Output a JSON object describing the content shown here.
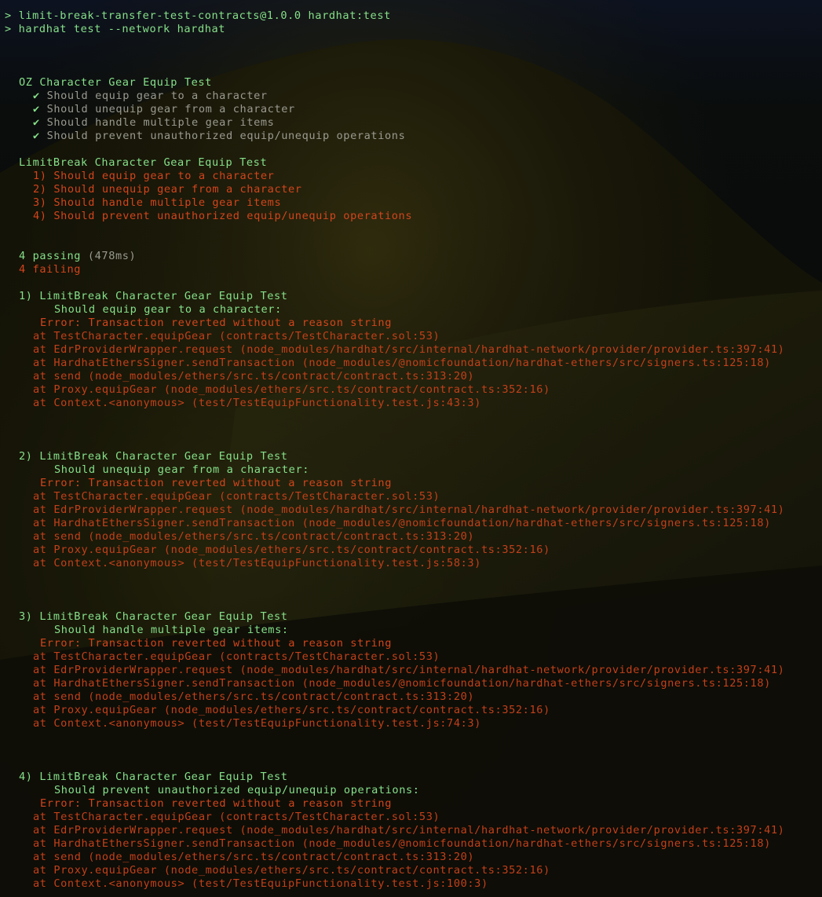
{
  "command_lines": [
    "> limit-break-transfer-test-contracts@1.0.0 hardhat:test",
    "> hardhat test --network hardhat"
  ],
  "suites": [
    {
      "title": "OZ Character Gear Equip Test",
      "status": "passed",
      "tests": [
        "✔ Should equip gear to a character",
        "✔ Should unequip gear from a character",
        "✔ Should handle multiple gear items",
        "✔ Should prevent unauthorized equip/unequip operations"
      ]
    },
    {
      "title": "LimitBreak Character Gear Equip Test",
      "status": "failed",
      "tests": [
        "1) Should equip gear to a character",
        "2) Should unequip gear from a character",
        "3) Should handle multiple gear items",
        "4) Should prevent unauthorized equip/unequip operations"
      ]
    }
  ],
  "summary": {
    "passing": "4 passing",
    "passing_time": "(478ms)",
    "failing": "4 failing"
  },
  "failures": [
    {
      "header": "1) LimitBreak Character Gear Equip Test",
      "test": "Should equip gear to a character:",
      "error": "Error: Transaction reverted without a reason string",
      "stack": [
        "at TestCharacter.equipGear (contracts/TestCharacter.sol:53)",
        "at EdrProviderWrapper.request (node_modules/hardhat/src/internal/hardhat-network/provider/provider.ts:397:41)",
        "at HardhatEthersSigner.sendTransaction (node_modules/@nomicfoundation/hardhat-ethers/src/signers.ts:125:18)",
        "at send (node_modules/ethers/src.ts/contract/contract.ts:313:20)",
        "at Proxy.equipGear (node_modules/ethers/src.ts/contract/contract.ts:352:16)",
        "at Context.<anonymous> (test/TestEquipFunctionality.test.js:43:3)"
      ]
    },
    {
      "header": "2) LimitBreak Character Gear Equip Test",
      "test": "Should unequip gear from a character:",
      "error": "Error: Transaction reverted without a reason string",
      "stack": [
        "at TestCharacter.equipGear (contracts/TestCharacter.sol:53)",
        "at EdrProviderWrapper.request (node_modules/hardhat/src/internal/hardhat-network/provider/provider.ts:397:41)",
        "at HardhatEthersSigner.sendTransaction (node_modules/@nomicfoundation/hardhat-ethers/src/signers.ts:125:18)",
        "at send (node_modules/ethers/src.ts/contract/contract.ts:313:20)",
        "at Proxy.equipGear (node_modules/ethers/src.ts/contract/contract.ts:352:16)",
        "at Context.<anonymous> (test/TestEquipFunctionality.test.js:58:3)"
      ]
    },
    {
      "header": "3) LimitBreak Character Gear Equip Test",
      "test": "Should handle multiple gear items:",
      "error": "Error: Transaction reverted without a reason string",
      "stack": [
        "at TestCharacter.equipGear (contracts/TestCharacter.sol:53)",
        "at EdrProviderWrapper.request (node_modules/hardhat/src/internal/hardhat-network/provider/provider.ts:397:41)",
        "at HardhatEthersSigner.sendTransaction (node_modules/@nomicfoundation/hardhat-ethers/src/signers.ts:125:18)",
        "at send (node_modules/ethers/src.ts/contract/contract.ts:313:20)",
        "at Proxy.equipGear (node_modules/ethers/src.ts/contract/contract.ts:352:16)",
        "at Context.<anonymous> (test/TestEquipFunctionality.test.js:74:3)"
      ]
    },
    {
      "header": "4) LimitBreak Character Gear Equip Test",
      "test": "Should prevent unauthorized equip/unequip operations:",
      "error": "Error: Transaction reverted without a reason string",
      "stack": [
        "at TestCharacter.equipGear (contracts/TestCharacter.sol:53)",
        "at EdrProviderWrapper.request (node_modules/hardhat/src/internal/hardhat-network/provider/provider.ts:397:41)",
        "at HardhatEthersSigner.sendTransaction (node_modules/@nomicfoundation/hardhat-ethers/src/signers.ts:125:18)",
        "at send (node_modules/ethers/src.ts/contract/contract.ts:313:20)",
        "at Proxy.equipGear (node_modules/ethers/src.ts/contract/contract.ts:352:16)",
        "at Context.<anonymous> (test/TestEquipFunctionality.test.js:100:3)"
      ]
    }
  ],
  "colors": {
    "prompt": "#86e08a",
    "pass": "#86e08a",
    "muted": "#9a9a90",
    "error": "#d2451c",
    "background": "#0b0c07"
  }
}
